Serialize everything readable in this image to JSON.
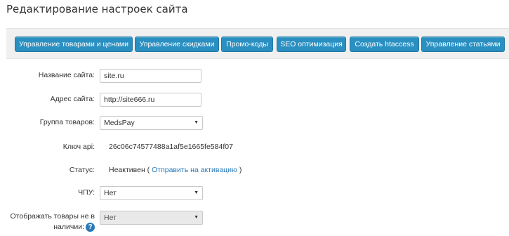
{
  "page": {
    "title": "Редактирование настроек сайта"
  },
  "toolbar": {
    "buttons": [
      {
        "label": "Управление товарами и ценами"
      },
      {
        "label": "Управление скидками"
      },
      {
        "label": "Промо-коды"
      },
      {
        "label": "SEO оптимизация"
      },
      {
        "label": "Создать htaccess"
      },
      {
        "label": "Управление статьями"
      }
    ]
  },
  "form": {
    "site_name": {
      "label": "Название сайта:",
      "value": "site.ru"
    },
    "site_address": {
      "label": "Адрес сайта:",
      "value": "http://site666.ru"
    },
    "product_group": {
      "label": "Группа товаров:",
      "value": "MedsPay"
    },
    "api_key": {
      "label": "Ключ api:",
      "value": "26c06c74577488a1af5e1665fe584f07"
    },
    "status": {
      "label": "Статус:",
      "value": "Неактивен (",
      "link": "Отправить на активацию",
      "suffix": " )"
    },
    "chpu": {
      "label": "ЧПУ:",
      "value": "Нет"
    },
    "show_unavailable": {
      "label": "Отображать товары не в наличии:",
      "value": "Нет",
      "help_icon": "?"
    }
  }
}
